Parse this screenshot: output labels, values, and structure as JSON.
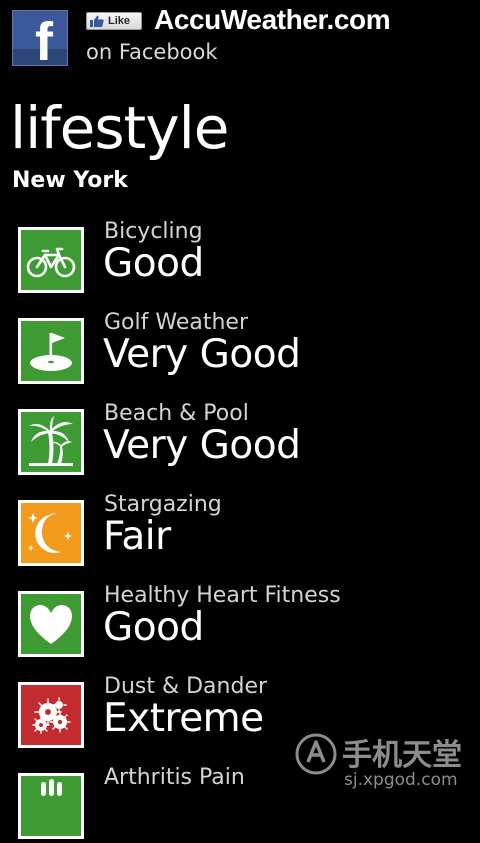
{
  "facebook_banner": {
    "logo_icon": "facebook-f-icon",
    "like_label": "Like",
    "brand": "AccuWeather.com",
    "subtitle": "on Facebook",
    "colors": {
      "facebook_blue": "#3b5998"
    }
  },
  "page": {
    "title": "lifestyle",
    "location": "New York"
  },
  "items": [
    {
      "name": "Bicycling",
      "rating": "Good",
      "icon": "bicycle-icon",
      "color": "#3e9b34"
    },
    {
      "name": "Golf Weather",
      "rating": "Very Good",
      "icon": "golf-flag-icon",
      "color": "#3e9b34"
    },
    {
      "name": "Beach & Pool",
      "rating": "Very Good",
      "icon": "palm-tree-icon",
      "color": "#3e9b34"
    },
    {
      "name": "Stargazing",
      "rating": "Fair",
      "icon": "moon-stars-icon",
      "color": "#f39b1d"
    },
    {
      "name": "Healthy Heart Fitness",
      "rating": "Good",
      "icon": "heart-icon",
      "color": "#3e9b34"
    },
    {
      "name": "Dust & Dander",
      "rating": "Extreme",
      "icon": "dust-icon",
      "color": "#c22c2f"
    },
    {
      "name": "Arthritis Pain",
      "rating": "",
      "icon": "arthritis-icon",
      "color": "#3e9b34"
    }
  ],
  "watermark": {
    "text": "手机天堂",
    "url": "sj.xpgod.com"
  }
}
